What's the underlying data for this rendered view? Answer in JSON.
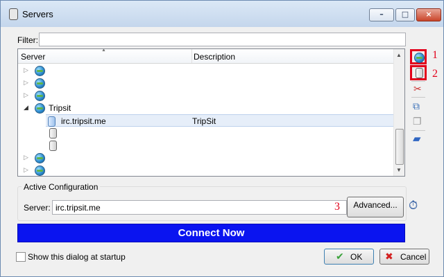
{
  "window": {
    "title": "Servers"
  },
  "filter": {
    "label": "Filter:",
    "value": ""
  },
  "tree": {
    "columns": [
      "Server",
      "Description"
    ],
    "rows": [
      {
        "type": "network",
        "name": "",
        "description": ""
      },
      {
        "type": "network",
        "name": "",
        "description": ""
      },
      {
        "type": "network",
        "name": "",
        "description": ""
      },
      {
        "type": "network",
        "name": "Tripsit",
        "description": "",
        "expanded": true
      },
      {
        "type": "server",
        "name": "irc.tripsit.me",
        "description": "TripSit",
        "selected": true
      },
      {
        "type": "server",
        "name": "",
        "description": ""
      },
      {
        "type": "server",
        "name": "",
        "description": ""
      },
      {
        "type": "network",
        "name": "",
        "description": ""
      },
      {
        "type": "network",
        "name": "",
        "description": ""
      }
    ]
  },
  "toolbar": {
    "callouts": [
      "1",
      "2",
      "3"
    ]
  },
  "active_configuration": {
    "title": "Active Configuration",
    "server_label": "Server:",
    "server_value": "irc.tripsit.me",
    "advanced_label": "Advanced..."
  },
  "connect_label": "Connect Now",
  "startup": {
    "label": "Show this dialog at startup",
    "checked": false
  },
  "buttons": {
    "ok": "OK",
    "cancel": "Cancel"
  },
  "colors": {
    "connect_bg": "#0a14f0",
    "highlight": "#e2001a"
  }
}
